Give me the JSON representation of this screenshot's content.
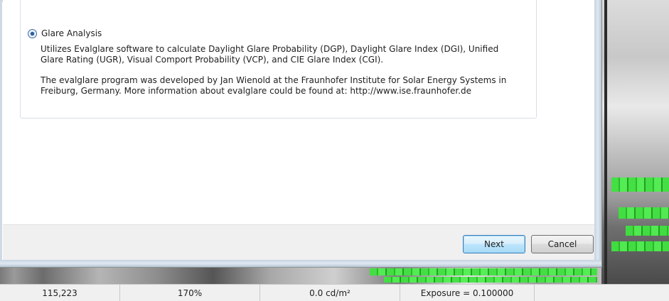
{
  "dialog": {
    "option": {
      "label": "Glare Analysis",
      "selected": true,
      "description_1": "Utilizes Evalglare software to calculate Daylight Glare Probability (DGP), Daylight Glare Index (DGI), Unified Glare Rating (UGR), Visual Comport Probability (VCP), and CIE Glare Index (CGI).",
      "description_2": "The evalglare program was developed by Jan Wienold at the Fraunhofer Institute for Solar Energy Systems in Freiburg, Germany. More information about evalglare could be found at: http://www.ise.fraunhofer.de"
    },
    "buttons": {
      "next": "Next",
      "cancel": "Cancel"
    }
  },
  "status_bar": {
    "coordinates": "115,223",
    "zoom": "170%",
    "luminance": "0.0 cd/m²",
    "exposure": "Exposure = 0.100000",
    "extra": ""
  },
  "colors": {
    "glare_overlay": "#3fe23f",
    "next_button_border": "#3c7fb1"
  }
}
